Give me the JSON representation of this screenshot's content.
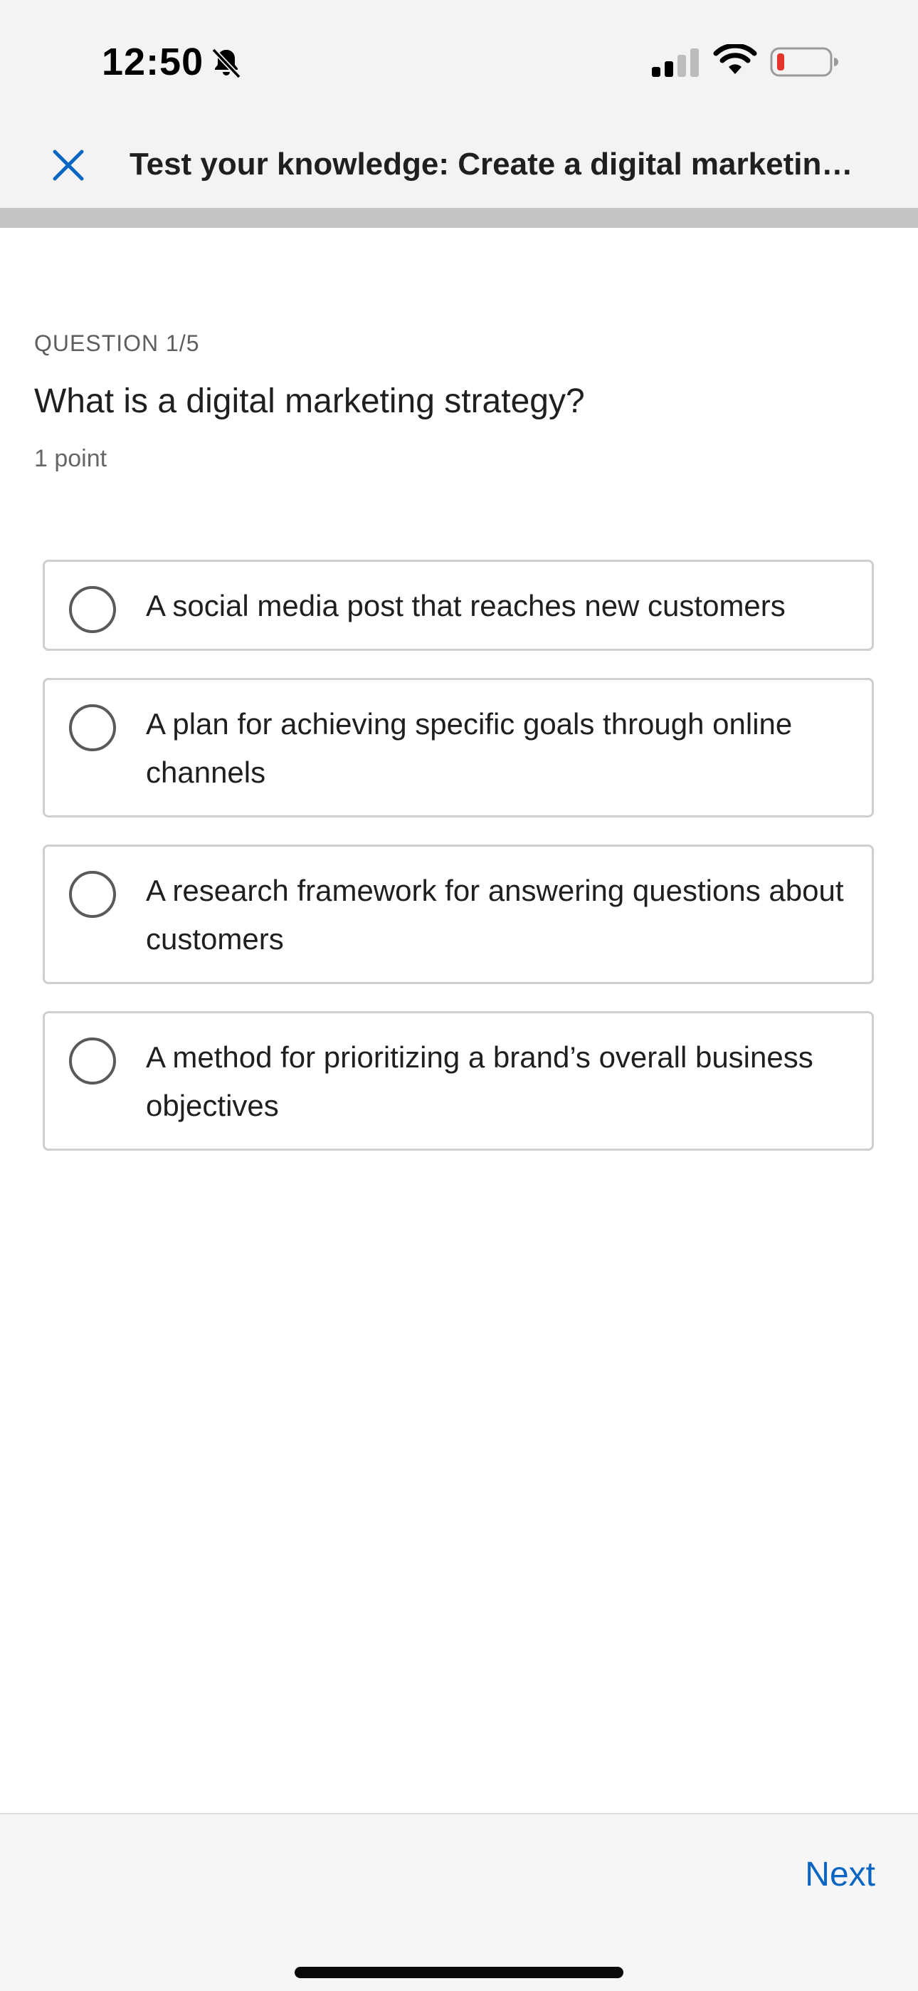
{
  "status_bar": {
    "time": "12:50",
    "icons": [
      "bell-slash-icon",
      "cellular-signal-icon",
      "wifi-icon",
      "battery-low-icon"
    ],
    "battery_color": "#e5352b"
  },
  "header": {
    "title": "Test your knowledge: Create a digital marketing a...",
    "close_icon": "close-icon",
    "close_color": "#0a66c2"
  },
  "progress": {
    "fraction": 0
  },
  "question": {
    "counter": "QUESTION 1/5",
    "text": "What is a digital marketing strategy?",
    "points": "1 point"
  },
  "options": [
    {
      "label": "A social media post that reaches new customers",
      "selected": false
    },
    {
      "label": "A plan for achieving specific goals through online channels",
      "selected": false
    },
    {
      "label": "A research framework for answering questions about customers",
      "selected": false
    },
    {
      "label": "A method for prioritizing a brand’s overall business objectives",
      "selected": false
    }
  ],
  "footer": {
    "next_label": "Next"
  },
  "colors": {
    "accent": "#0a66c2",
    "border": "#cfcfcf",
    "progress_track": "#c4c4c4"
  }
}
